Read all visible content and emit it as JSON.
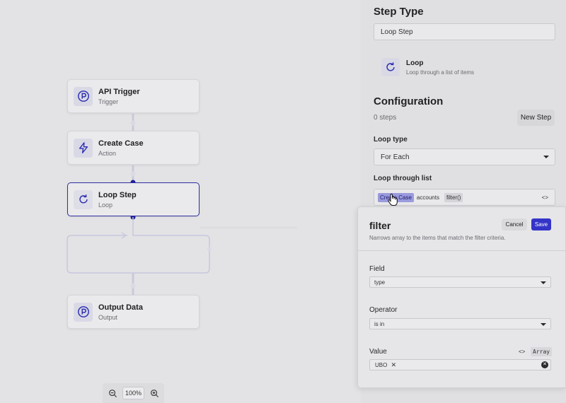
{
  "canvas": {
    "nodes": [
      {
        "title": "API Trigger",
        "subtitle": "Trigger",
        "icon": "p-circle-icon"
      },
      {
        "title": "Create Case",
        "subtitle": "Action",
        "icon": "lightning-icon"
      },
      {
        "title": "Loop Step",
        "subtitle": "Loop",
        "icon": "refresh-icon"
      },
      {
        "title": "Output Data",
        "subtitle": "Output",
        "icon": "p-circle-icon"
      }
    ],
    "zoom": "100%"
  },
  "panel": {
    "step_type_heading": "Step Type",
    "step_type_value": "Loop Step",
    "loop_card": {
      "title": "Loop",
      "description": "Loop through a list of items"
    },
    "configuration_heading": "Configuration",
    "steps_count": "0 steps",
    "new_step_label": "New Step",
    "loop_type_label": "Loop type",
    "loop_type_value": "For Each",
    "loop_list_label": "Loop through list",
    "loop_list_chips": [
      "Create Case",
      "accounts",
      "filter()"
    ],
    "code_toggle": "<>"
  },
  "filter_popover": {
    "title": "filter",
    "description": "Narrows array to the items that match the filter criteria.",
    "cancel_label": "Cancel",
    "save_label": "Save",
    "field_label": "Field",
    "field_value": "type",
    "operator_label": "Operator",
    "operator_value": "is in",
    "value_label": "Value",
    "value_code_toggle": "<>",
    "value_type_badge": "Array",
    "value_tags": [
      "UBO"
    ]
  },
  "colors": {
    "accent": "#3434c8",
    "node_border_selected": "#2f2fa2",
    "chip_highlight": "#9a9ade"
  }
}
